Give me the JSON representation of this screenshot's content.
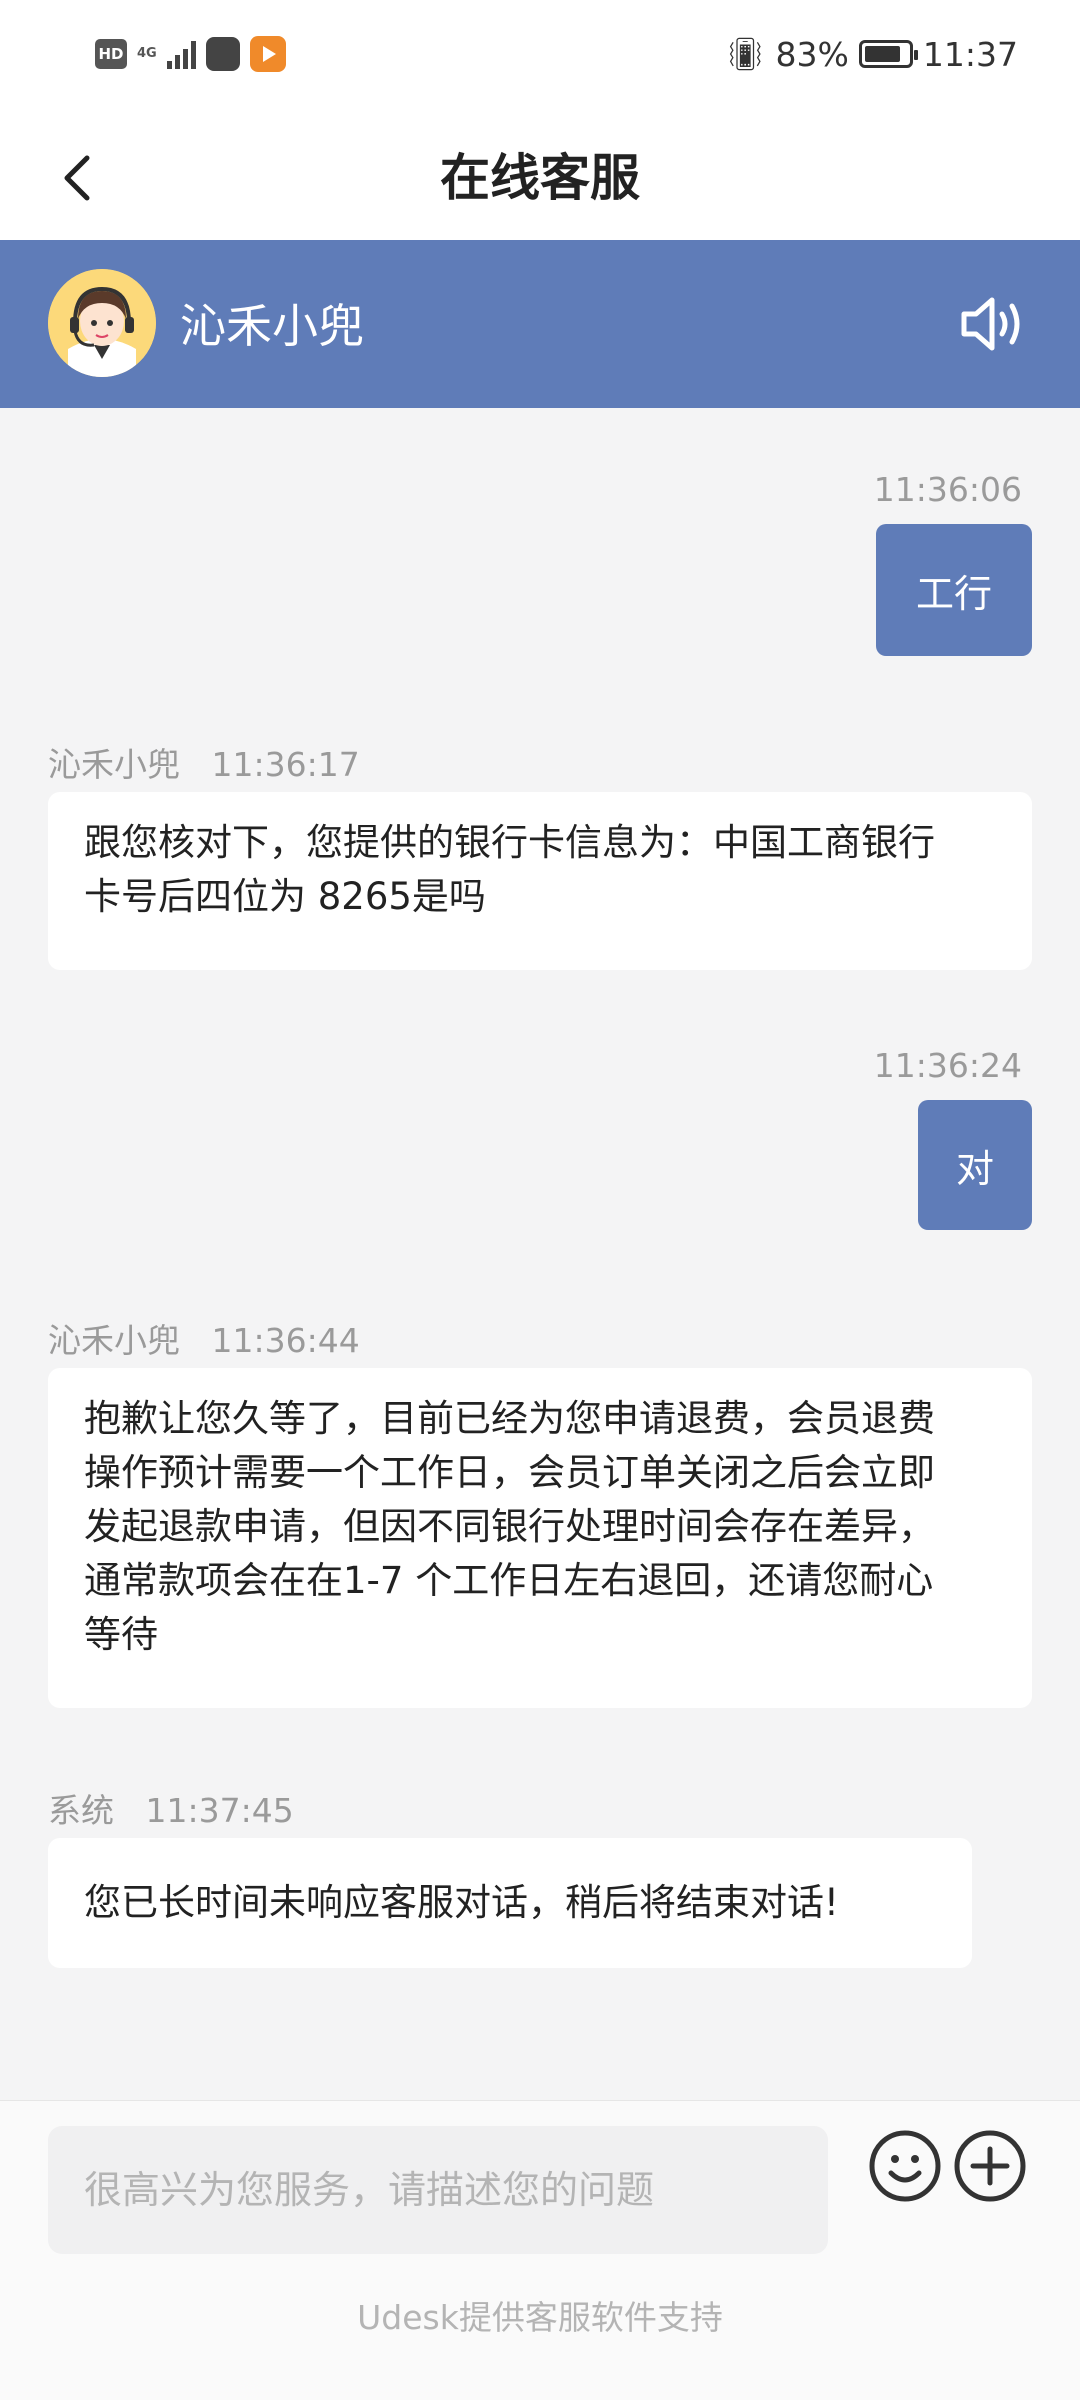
{
  "status_bar": {
    "hd_label": "HD",
    "network": "4G",
    "battery_percent": "83%",
    "time": "11:37"
  },
  "nav": {
    "title": "在线客服"
  },
  "agent": {
    "name": "沁禾小兜"
  },
  "messages": [
    {
      "direction": "out",
      "time": "11:36:06",
      "text": "工行"
    },
    {
      "direction": "in",
      "sender": "沁禾小兜",
      "time": "11:36:17",
      "lines": [
        "跟您核对下，您提供的银行卡信息为：中国工商银行",
        "卡号后四位为 8265是吗"
      ]
    },
    {
      "direction": "out",
      "time": "11:36:24",
      "text": "对"
    },
    {
      "direction": "in",
      "sender": "沁禾小兜",
      "time": "11:36:44",
      "lines": [
        "抱歉让您久等了，目前已经为您申请退费，会员退费",
        "操作预计需要一个工作日，会员订单关闭之后会立即",
        "发起退款申请，但因不同银行处理时间会存在差异，",
        "通常款项会在在1-7 个工作日左右退回，还请您耐心",
        "等待"
      ]
    },
    {
      "direction": "in",
      "sender": "系统",
      "time": "11:37:45",
      "lines": [
        "您已长时间未响应客服对话，稍后将结束对话!"
      ]
    }
  ],
  "input": {
    "placeholder": "很高兴为您服务，请描述您的问题"
  },
  "footer": {
    "powered_by": "Udesk提供客服软件支持"
  },
  "colors": {
    "accent": "#5f7cb8",
    "chat_background": "#f4f4f5"
  }
}
